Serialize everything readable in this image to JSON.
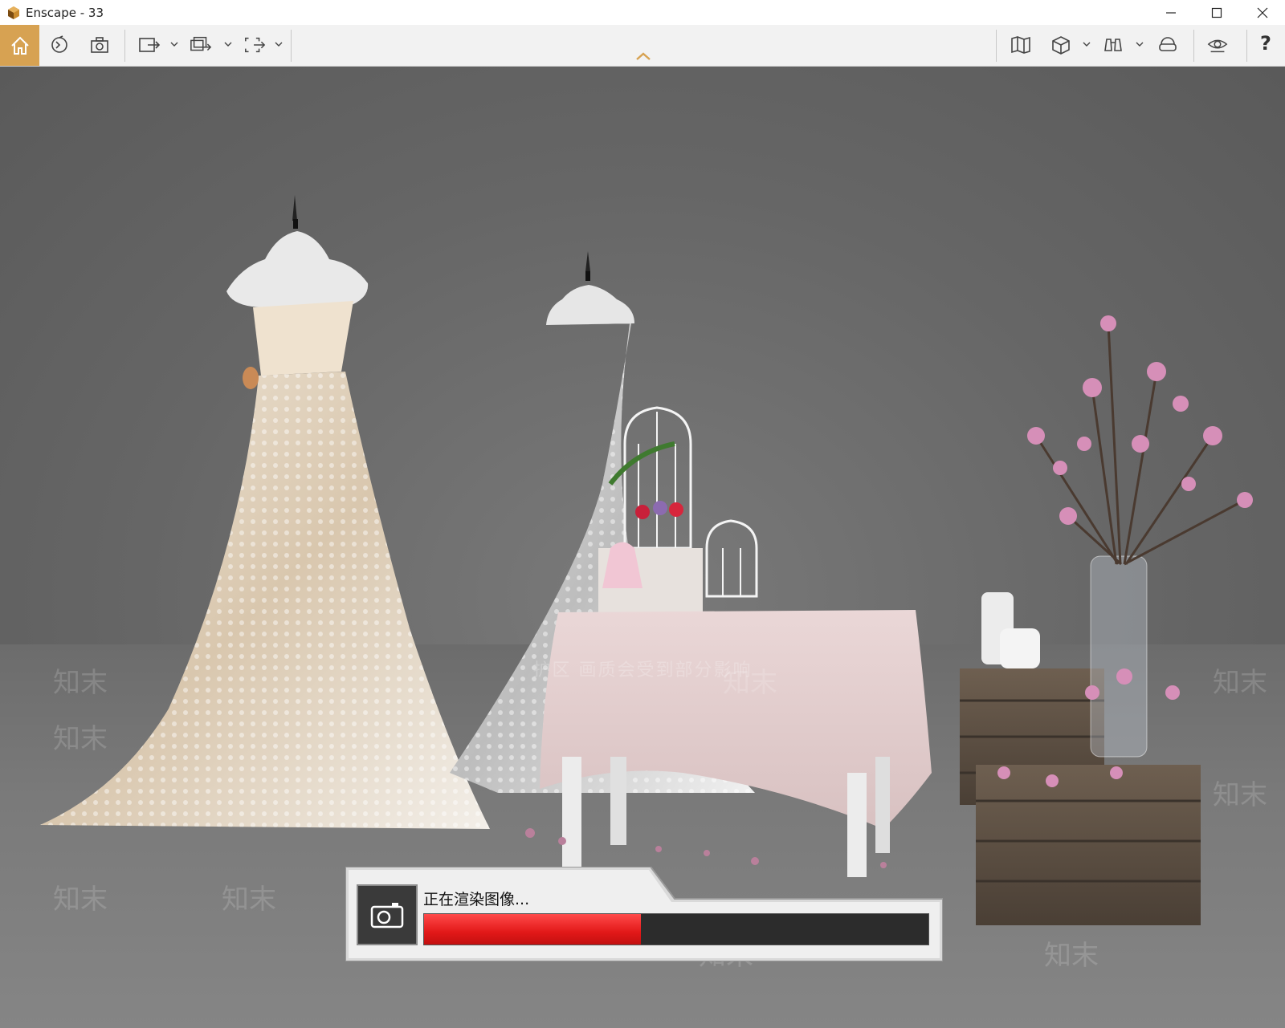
{
  "window": {
    "title": "Enscape - 33",
    "controls": [
      "minimize-icon",
      "maximize-icon",
      "close-icon"
    ]
  },
  "toolbar": {
    "left_icons": [
      "home-icon",
      "sync-icon",
      "screenshot-icon",
      "export-icon",
      "batch-render-icon",
      "panorama-icon"
    ],
    "right_icons": [
      "map-icon",
      "cube-view-icon",
      "binoculars-icon",
      "vr-headset-icon",
      "visual-settings-icon"
    ],
    "help_label": "?",
    "collapse_icon": "chevron-up-icon",
    "accent_color": "#d7a252"
  },
  "viewport": {
    "watermark_text": "护区   画质会受到部分影响",
    "watermark_logo": "知末"
  },
  "render_status": {
    "label": "正在渲染图像...",
    "progress": 0.43,
    "bar_color": "#e21818",
    "camera_icon": "camera-icon"
  }
}
